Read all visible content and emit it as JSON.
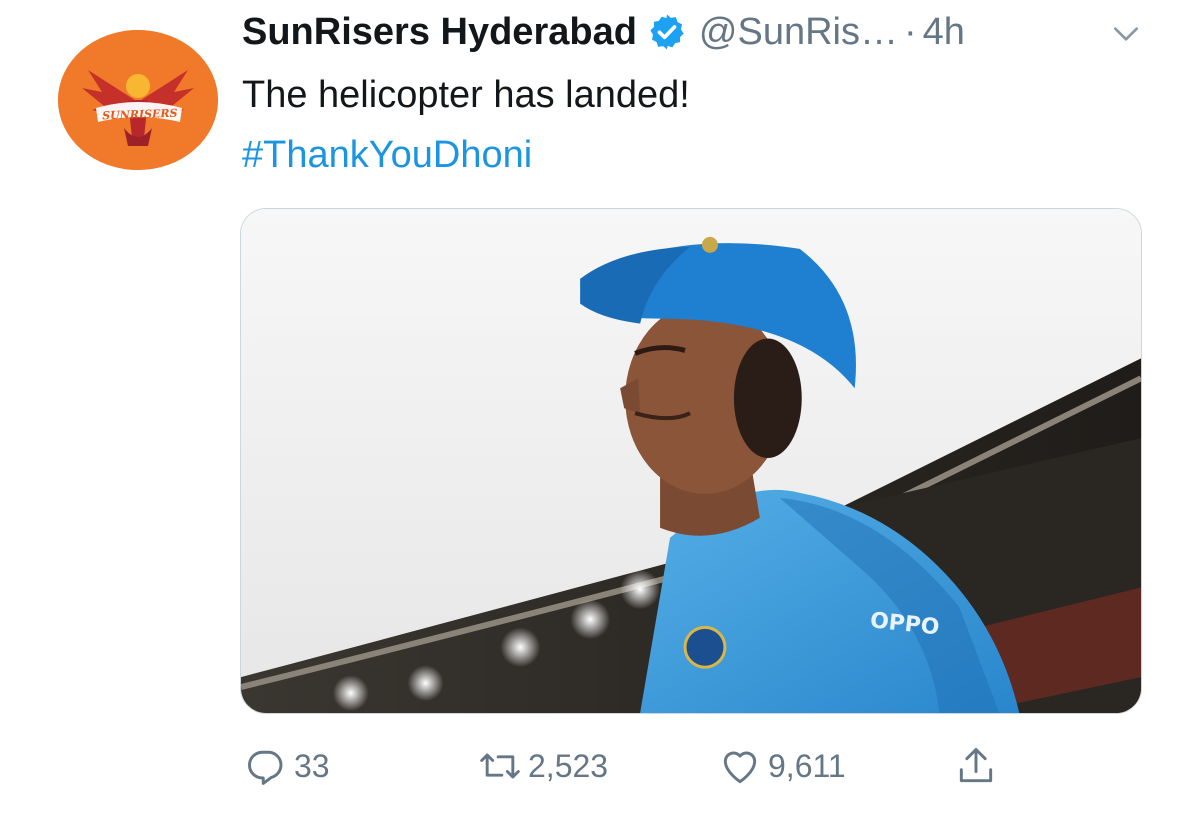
{
  "tweet": {
    "display_name": "SunRisers Hyderabad",
    "verified": true,
    "handle": "@SunRis…",
    "separator": "·",
    "time": "4h",
    "text": "The helicopter has landed!",
    "hashtag": "#ThankYouDhoni",
    "avatar_logo_text": "SUNRISERS",
    "avatar_color": "#f07a2a",
    "accent_color": "#1b95e0",
    "media": {
      "description_icon": "photo",
      "jersey_text": "OPPO"
    },
    "actions": {
      "reply_count": "33",
      "retweet_count": "2,523",
      "like_count": "9,611"
    },
    "icons": [
      "verified-badge-icon",
      "chevron-down-icon",
      "reply-icon",
      "retweet-icon",
      "like-icon",
      "share-icon"
    ]
  }
}
